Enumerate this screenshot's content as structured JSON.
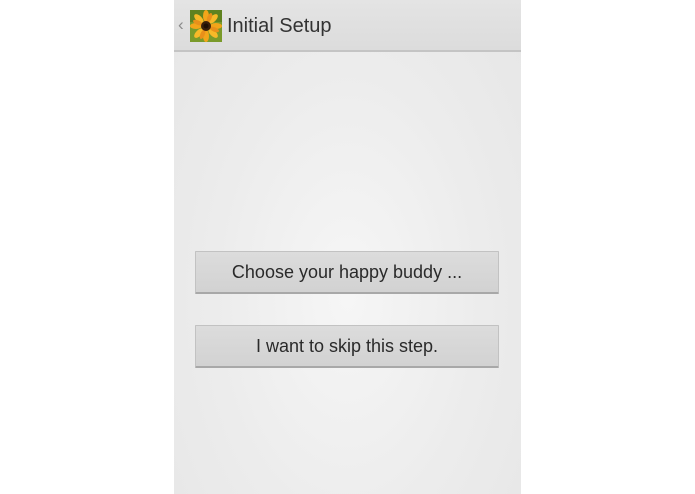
{
  "action_bar": {
    "title": "Initial Setup",
    "up_caret": "‹",
    "app_icon": "sunflower-icon"
  },
  "main": {
    "choose_buddy_label": "Choose your happy buddy ...",
    "skip_step_label": "I want to skip this step."
  },
  "colors": {
    "action_bar_bg": "#dcdcdc",
    "button_bg": "#d6d6d6",
    "text": "#333333"
  }
}
